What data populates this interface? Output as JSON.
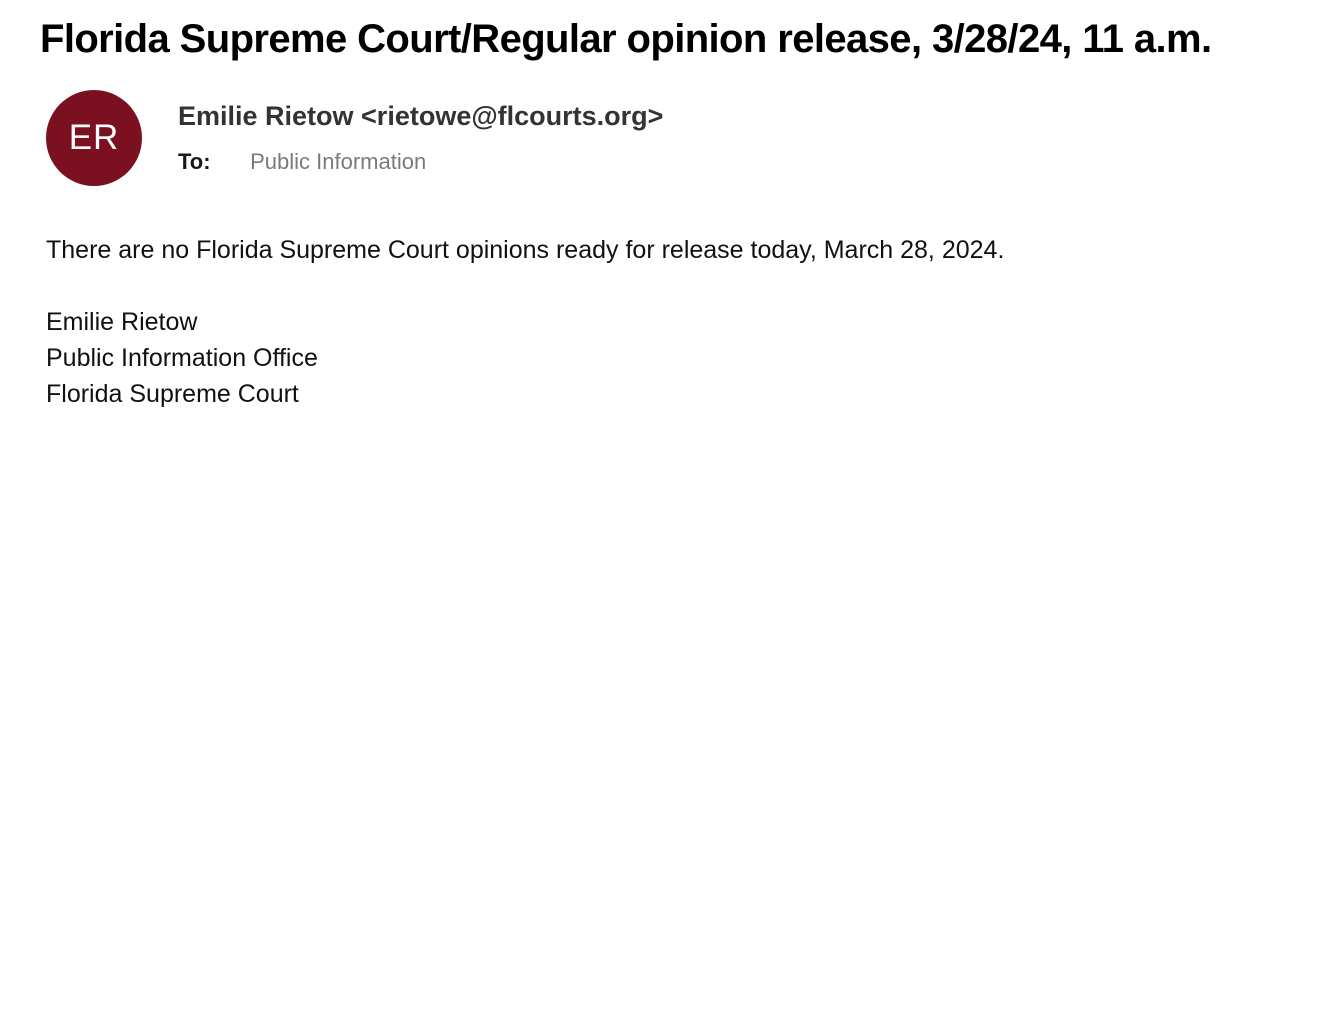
{
  "email": {
    "subject": "Florida Supreme Court/Regular opinion release, 3/28/24, 11 a.m.",
    "avatar": {
      "initials": "ER",
      "color": "#7b1120"
    },
    "sender": "Emilie Rietow <rietowe@flcourts.org>",
    "to_label": "To:",
    "to_value": "Public Information",
    "body": {
      "message": "There are no Florida Supreme Court opinions ready for release today, March 28, 2024.",
      "signature": [
        "Emilie Rietow",
        "Public Information Office",
        "Florida Supreme Court"
      ]
    }
  }
}
